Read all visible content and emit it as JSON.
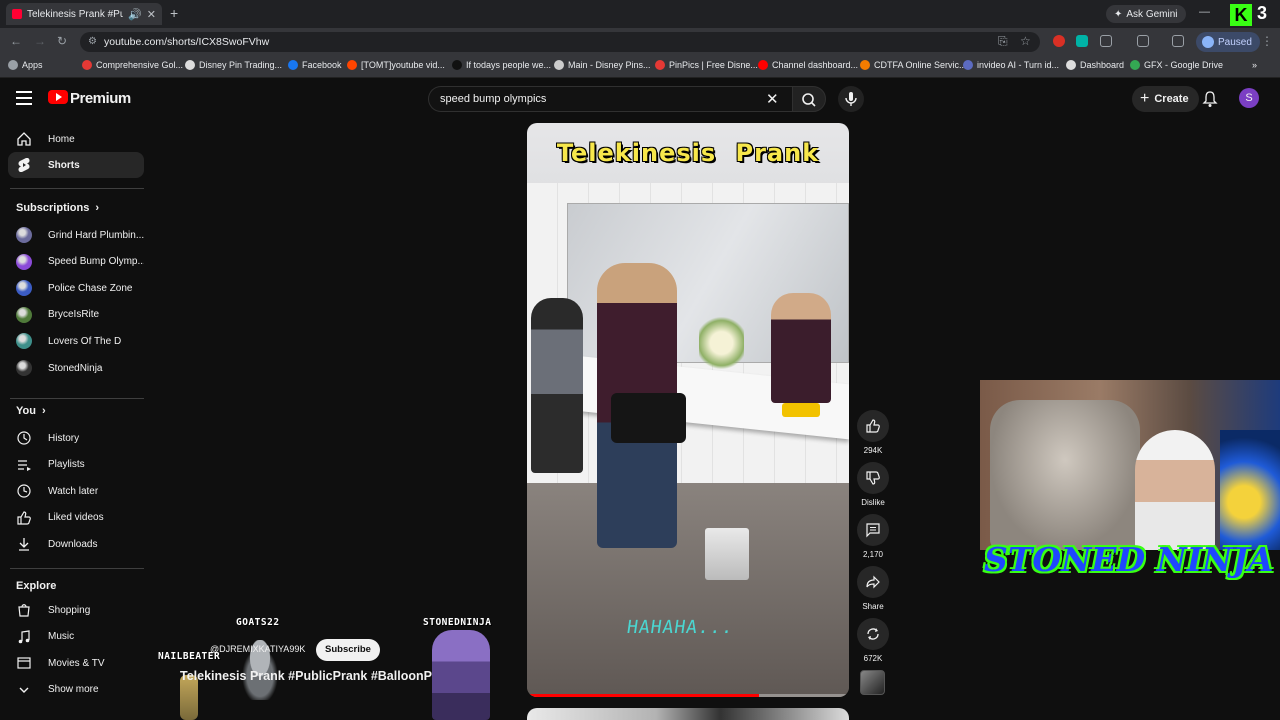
{
  "browser": {
    "tab_title": "Telekinesis Prank #PublicPr",
    "url": "youtube.com/shorts/ICX8SwoFVhw",
    "ask_gemini": "Ask Gemini",
    "profile_status": "Paused",
    "kick_number": "3",
    "bookmarks": [
      {
        "label": "Apps",
        "color": "#9aa0a6"
      },
      {
        "label": "Comprehensive Gol...",
        "color": "#e53935"
      },
      {
        "label": "Disney Pin Trading...",
        "color": "#dddddd"
      },
      {
        "label": "Facebook",
        "color": "#1877f2"
      },
      {
        "label": "[TOMT]youtube vid...",
        "color": "#ff4500"
      },
      {
        "label": "If todays people we...",
        "color": "#111111"
      },
      {
        "label": "Main - Disney Pins...",
        "color": "#cccccc"
      },
      {
        "label": "PinPics | Free Disne...",
        "color": "#e53935"
      },
      {
        "label": "Channel dashboard...",
        "color": "#ff0000"
      },
      {
        "label": "CDTFA Online Servic...",
        "color": "#f57c00"
      },
      {
        "label": "invideo AI - Turn id...",
        "color": "#5c6bc0"
      },
      {
        "label": "Dashboard",
        "color": "#dddddd"
      },
      {
        "label": "GFX - Google Drive",
        "color": "#34a853"
      }
    ]
  },
  "masthead": {
    "logo_text": "Premium",
    "search_value": "speed bump olympics",
    "create_label": "Create",
    "avatar_letter": "S"
  },
  "sidebar": {
    "main": [
      {
        "label": "Home",
        "icon": "home-icon"
      },
      {
        "label": "Shorts",
        "icon": "shorts-icon",
        "active": true
      }
    ],
    "subscriptions_header": "Subscriptions",
    "subscriptions": [
      {
        "label": "Grind Hard Plumbin...",
        "color": "#6b6b9c"
      },
      {
        "label": "Speed Bump Olymp...",
        "color": "#8b4bd8"
      },
      {
        "label": "Police Chase Zone",
        "color": "#3b5cc4"
      },
      {
        "label": "BryceIsRite",
        "color": "#4f7a3a"
      },
      {
        "label": "Lovers Of The D",
        "color": "#3e8f8a"
      },
      {
        "label": "StonedNinja",
        "color": "#333333"
      }
    ],
    "you_header": "You",
    "you": [
      {
        "label": "History",
        "icon": "history-icon"
      },
      {
        "label": "Playlists",
        "icon": "playlists-icon"
      },
      {
        "label": "Watch later",
        "icon": "watch-later-icon"
      },
      {
        "label": "Liked videos",
        "icon": "liked-videos-icon"
      },
      {
        "label": "Downloads",
        "icon": "downloads-icon"
      }
    ],
    "explore_header": "Explore",
    "explore": [
      {
        "label": "Shopping",
        "icon": "shopping-icon"
      },
      {
        "label": "Music",
        "icon": "music-icon"
      },
      {
        "label": "Movies & TV",
        "icon": "movies-icon"
      },
      {
        "label": "Show more",
        "icon": "chevron-down-icon"
      }
    ]
  },
  "short": {
    "overlay_title": "Telekinesis Prank",
    "overlay_caption": "HAHAHA...",
    "progress": 0.72,
    "channel": "@DJREMIXKATIYA99K",
    "subscribe_label": "Subscribe",
    "caption": "Telekinesis Prank #PublicPrank #BalloonP"
  },
  "actions": {
    "likes": "294K",
    "dislike_label": "Dislike",
    "comments": "2,170",
    "share_label": "Share",
    "remix_count": "672K"
  },
  "stream_overlay": {
    "streamer_name": "STONED NINJA",
    "viewer_tags": [
      "GOATS22",
      "STONEDNINJA",
      "NAILBEATER"
    ]
  }
}
